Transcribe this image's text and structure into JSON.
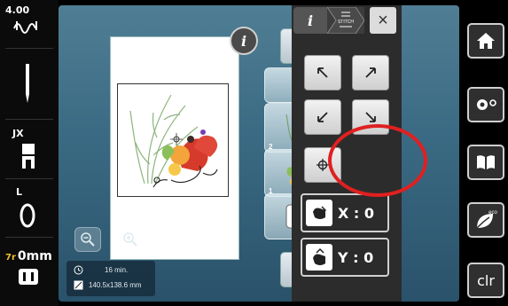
{
  "left_status": {
    "needle_thread_tension": "4.00",
    "presser_foot": "JX",
    "bobbin": "L",
    "stitch_offset_prefix": "7r",
    "stitch_offset": "0mm"
  },
  "main": {
    "info_icon": "i",
    "zoom_out_icon": "zoom-out",
    "zoom_in_icon": "zoom-in",
    "stitch_time": "16 min.",
    "design_size": "140.5x138.6 mm",
    "layers": [
      {
        "number": "",
        "label": "add-layer"
      },
      {
        "number": "2",
        "label": "layer-2-grass"
      },
      {
        "number": "1",
        "label": "layer-1-flowers"
      },
      {
        "number": "",
        "label": "hoop-view"
      }
    ]
  },
  "edit_panel": {
    "tab_info": "i",
    "tab_stitch_label": "STITCH",
    "close": "×",
    "x_label": "X : 0",
    "y_label": "Y : 0"
  },
  "system": {
    "home_icon": "home-icon",
    "settings_icon": "gear-icon",
    "tutorial_icon": "book-icon",
    "eco_label": "eco",
    "clear_label": "clr"
  },
  "colors": {
    "highlight_ring": "#e02020",
    "panel_bg": "#2c2c2c",
    "screen_bg": "#3a6a83"
  }
}
